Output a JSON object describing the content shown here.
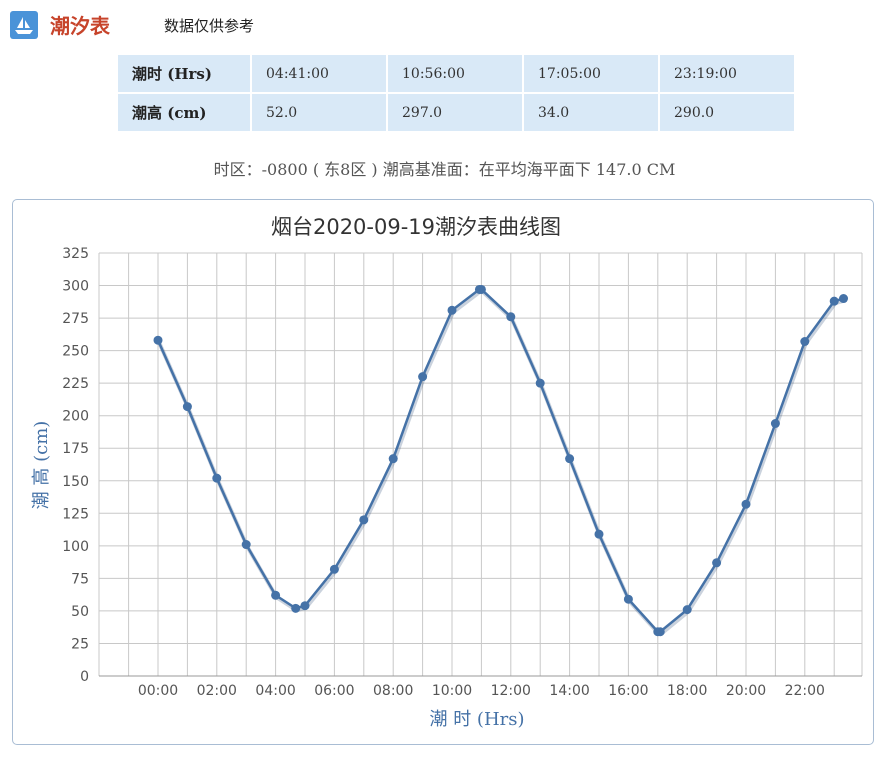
{
  "header": {
    "title": "潮汐表",
    "note": "数据仅供参考",
    "logo_icon": "boat-icon"
  },
  "tide_table": {
    "rows": [
      {
        "label": "潮时 (Hrs)",
        "values": [
          "04:41:00",
          "10:56:00",
          "17:05:00",
          "23:19:00"
        ]
      },
      {
        "label": "潮高 (cm)",
        "values": [
          "52.0",
          "297.0",
          "34.0",
          "290.0"
        ]
      }
    ]
  },
  "timezone_note": "时区：-0800 ( 东8区 ) 潮高基准面：在平均海平面下 147.0 CM",
  "chart_data": {
    "type": "line",
    "title": "烟台2020-09-19潮汐表曲线图",
    "xlabel": "潮 时 (Hrs)",
    "ylabel": "潮 高 (cm)",
    "ylim": [
      0,
      325
    ],
    "yticks": [
      0,
      25,
      50,
      75,
      100,
      125,
      150,
      175,
      200,
      225,
      250,
      275,
      300,
      325
    ],
    "xlim": [
      -1,
      23.5
    ],
    "xtick_values": [
      0,
      2,
      4,
      6,
      8,
      10,
      12,
      14,
      16,
      18,
      20,
      22
    ],
    "xtick_labels": [
      "00:00",
      "02:00",
      "04:00",
      "06:00",
      "08:00",
      "10:00",
      "12:00",
      "14:00",
      "16:00",
      "18:00",
      "20:00",
      "22:00"
    ],
    "grid": true,
    "series": [
      {
        "color": "#4572a7",
        "points": [
          {
            "t": "00:00",
            "x": 0,
            "y": 258
          },
          {
            "t": "01:00",
            "x": 1,
            "y": 207
          },
          {
            "t": "02:00",
            "x": 2,
            "y": 152
          },
          {
            "t": "03:00",
            "x": 3,
            "y": 101
          },
          {
            "t": "04:00",
            "x": 4,
            "y": 62
          },
          {
            "t": "04:41",
            "x": 4.683,
            "y": 52
          },
          {
            "t": "05:00",
            "x": 5,
            "y": 54
          },
          {
            "t": "06:00",
            "x": 6,
            "y": 82
          },
          {
            "t": "07:00",
            "x": 7,
            "y": 120
          },
          {
            "t": "08:00",
            "x": 8,
            "y": 167
          },
          {
            "t": "09:00",
            "x": 9,
            "y": 230
          },
          {
            "t": "10:00",
            "x": 10,
            "y": 281
          },
          {
            "t": "10:56",
            "x": 10.933,
            "y": 297
          },
          {
            "t": "11:00",
            "x": 11,
            "y": 297
          },
          {
            "t": "12:00",
            "x": 12,
            "y": 276
          },
          {
            "t": "13:00",
            "x": 13,
            "y": 225
          },
          {
            "t": "14:00",
            "x": 14,
            "y": 167
          },
          {
            "t": "15:00",
            "x": 15,
            "y": 109
          },
          {
            "t": "16:00",
            "x": 16,
            "y": 59
          },
          {
            "t": "17:00",
            "x": 17,
            "y": 34
          },
          {
            "t": "17:05",
            "x": 17.083,
            "y": 34
          },
          {
            "t": "18:00",
            "x": 18,
            "y": 51
          },
          {
            "t": "19:00",
            "x": 19,
            "y": 87
          },
          {
            "t": "20:00",
            "x": 20,
            "y": 132
          },
          {
            "t": "21:00",
            "x": 21,
            "y": 194
          },
          {
            "t": "22:00",
            "x": 22,
            "y": 257
          },
          {
            "t": "23:00",
            "x": 23,
            "y": 288
          },
          {
            "t": "23:19",
            "x": 23.317,
            "y": 290
          }
        ]
      }
    ]
  }
}
